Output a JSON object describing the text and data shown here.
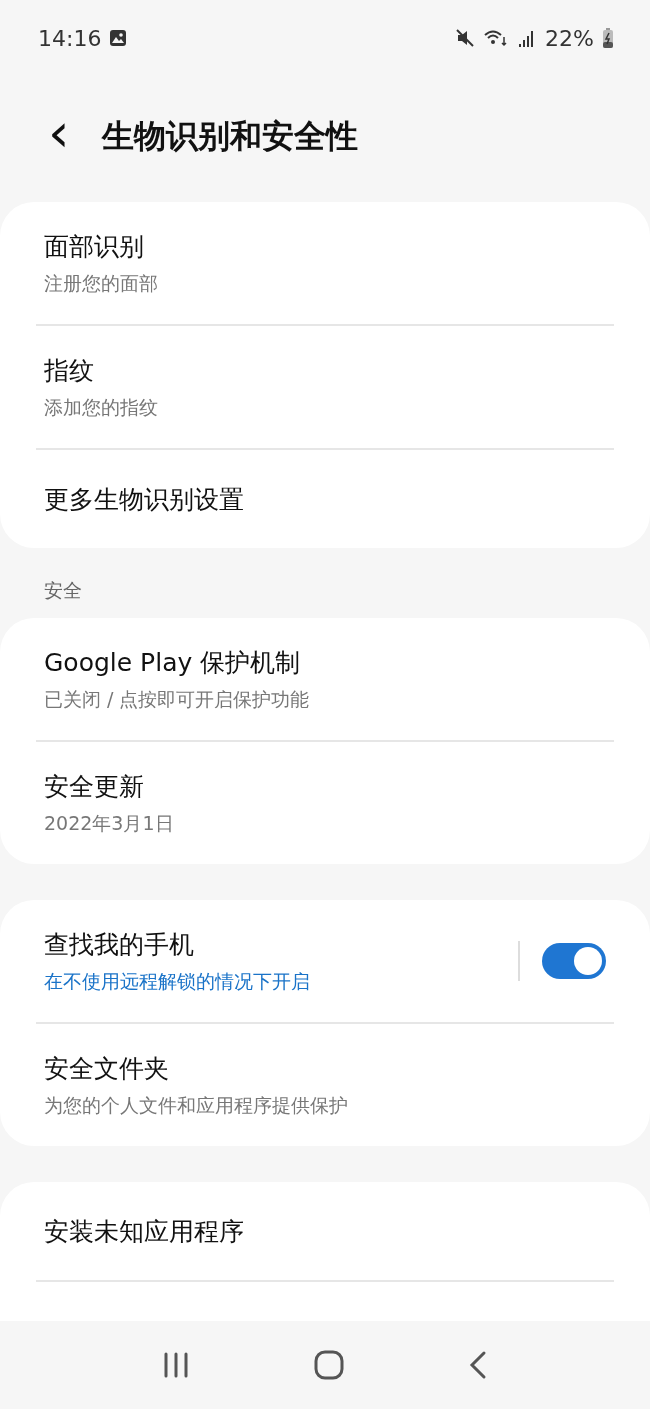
{
  "status_bar": {
    "time": "14:16",
    "battery": "22%"
  },
  "header": {
    "back": "‹",
    "title": "生物识别和安全性"
  },
  "groups": [
    {
      "rows": [
        {
          "kind": "link",
          "title": "面部识别",
          "subtitle": "注册您的面部"
        },
        {
          "kind": "link",
          "title": "指纹",
          "subtitle": "添加您的指纹"
        },
        {
          "kind": "link",
          "title": "更多生物识别设置"
        }
      ]
    },
    {
      "section": "安全",
      "rows": [
        {
          "kind": "link",
          "title": "Google Play 保护机制",
          "subtitle": "已关闭 / 点按即可开启保护功能"
        },
        {
          "kind": "link",
          "title": "安全更新",
          "subtitle": "2022年3月1日"
        }
      ]
    },
    {
      "rows": [
        {
          "kind": "switch",
          "title": "查找我的手机",
          "subtitle": "在不使用远程解锁的情况下开启",
          "on": true
        },
        {
          "kind": "link",
          "title": "安全文件夹",
          "subtitle": "为您的个人文件和应用程序提供保护"
        }
      ]
    },
    {
      "rows": [
        {
          "kind": "link",
          "title": "安装未知应用程序"
        },
        {
          "kind": "partial"
        }
      ]
    }
  ]
}
